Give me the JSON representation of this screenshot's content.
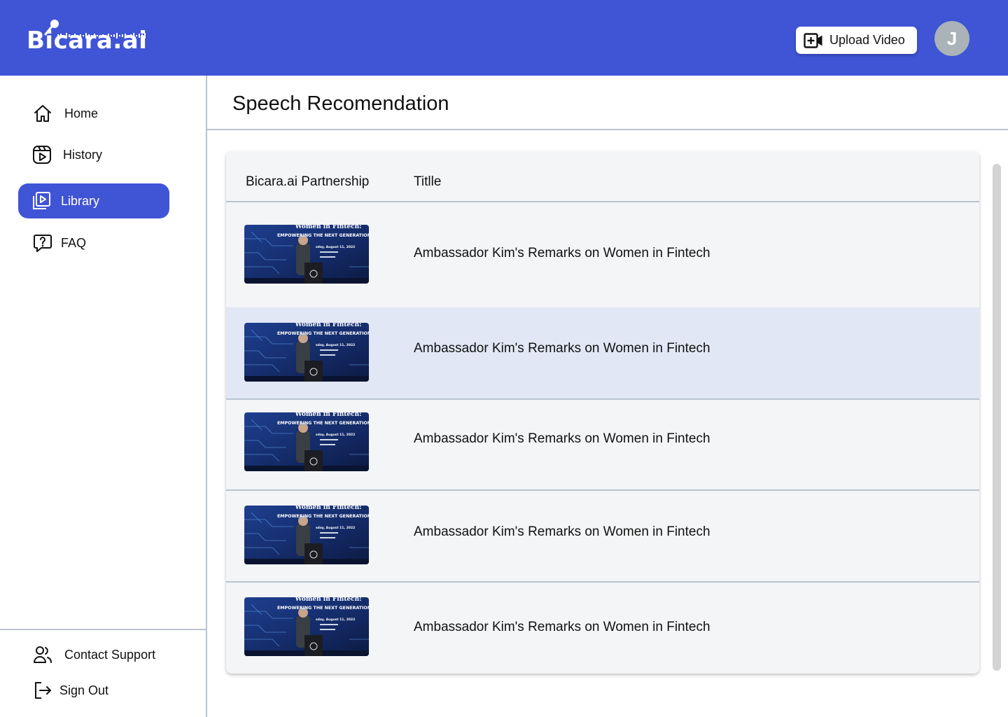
{
  "header": {
    "logo_text": "Bicara.ai",
    "upload_label": "Upload Video",
    "avatar_initial": "J",
    "brand_color": "#4054d6"
  },
  "sidebar": {
    "items": [
      {
        "label": "Home",
        "icon": "home-icon"
      },
      {
        "label": "History",
        "icon": "history-icon"
      },
      {
        "label": "Library",
        "icon": "library-icon",
        "active": true
      },
      {
        "label": "FAQ",
        "icon": "faq-icon"
      }
    ],
    "footer": [
      {
        "label": "Contact Support",
        "icon": "contact-support-icon"
      },
      {
        "label": "Sign Out",
        "icon": "sign-out-icon"
      }
    ]
  },
  "main": {
    "title": "Speech Recomendation",
    "table": {
      "headers": [
        "Bicara.ai Partnership",
        "Titlle"
      ],
      "rows": [
        {
          "title": "Ambassador Kim's Remarks on Women in Fintech",
          "thumb": {
            "line1": "Women in Fintech:",
            "line2": "EMPOWERING THE NEXT GENERATION",
            "line3": "sday, August 11, 2022"
          }
        },
        {
          "title": "Ambassador Kim's Remarks on Women in Fintech",
          "thumb": {
            "line1": "Women in Fintech:",
            "line2": "EMPOWERING THE NEXT GENERATION",
            "line3": "sday, August 11, 2022"
          },
          "highlighted": true
        },
        {
          "title": "Ambassador Kim's Remarks on Women in Fintech",
          "thumb": {
            "line1": "Women in Fintech:",
            "line2": "EMPOWERING THE NEXT GENERATION",
            "line3": "sday, August 11, 2022"
          }
        },
        {
          "title": "Ambassador Kim's Remarks on Women in Fintech",
          "thumb": {
            "line1": "Women in Fintech:",
            "line2": "EMPOWERING THE NEXT GENERATION",
            "line3": "sday, August 11, 2022"
          }
        },
        {
          "title": "Ambassador Kim's Remarks on Women in Fintech",
          "thumb": {
            "line1": "Women in Fintech:",
            "line2": "EMPOWERING THE NEXT GENERATION",
            "line3": "sday, August 11, 2022"
          }
        }
      ]
    }
  }
}
